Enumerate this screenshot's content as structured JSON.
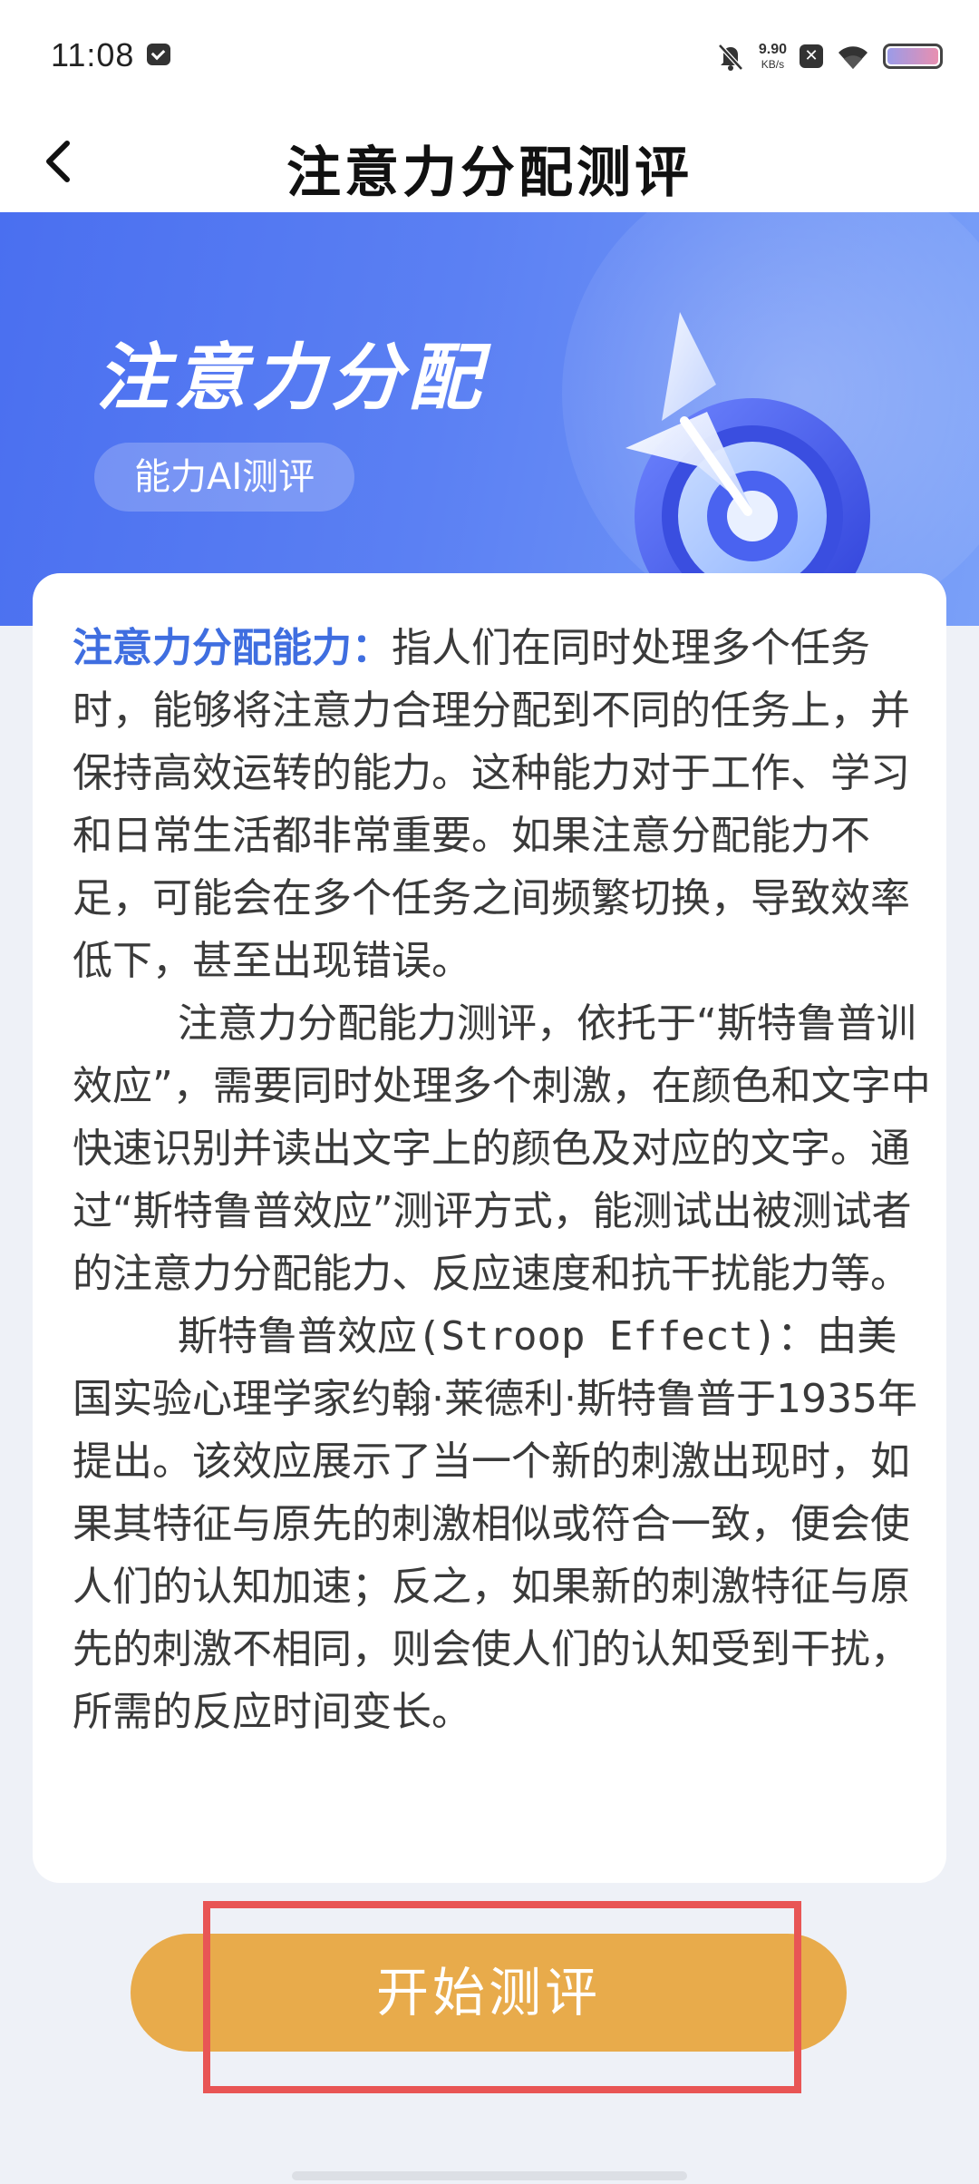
{
  "status_bar": {
    "time": "11:08",
    "network_speed_value": "9.90",
    "network_speed_unit": "KB/s",
    "icons": [
      "message-icon",
      "bell-off-icon",
      "close-box-icon",
      "wifi-icon",
      "battery-icon"
    ]
  },
  "nav": {
    "back_icon": "chevron-left-icon",
    "title": "注意力分配测评"
  },
  "hero": {
    "title": "注意力分配",
    "tag": "能力AI测评",
    "icon": "target-arrow-icon"
  },
  "description": {
    "highlight": "注意力分配能力：",
    "para1_rest": "指人们在同时处理多个任务时，能够将注意力合理分配到不同的任务上，并保持高效运转的能力。这种能力对于工作、学习和日常生活都非常重要。如果注意分配能力不足，可能会在多个任务之间频繁切换，导致效率低下，甚至出现错误。",
    "para2": "注意力分配能力测评，依托于“斯特鲁普训效应”，需要同时处理多个刺激，在颜色和文字中快速识别并读出文字上的颜色及对应的文字。通过“斯特鲁普效应”测评方式，能测试出被测试者的注意力分配能力、反应速度和抗干扰能力等。",
    "para3_prefix": "斯特鲁普效应",
    "para3_en": "(Stroop Effect)：",
    "para3_rest": "由美国实验心理学家约翰·莱德利·斯特鲁普于1935年提出。该效应展示了当一个新的刺激出现时，如果其特征与原先的刺激相似或符合一致，便会使人们的认知加速；反之，如果新的刺激特征与原先的刺激不相同，则会使人们的认知受到干扰，所需的反应时间变长。"
  },
  "actions": {
    "start_label": "开始测评"
  },
  "colors": {
    "accent_blue": "#3f6ee0",
    "button_orange": "#e8ab4b",
    "annotation_red": "#e85555"
  }
}
